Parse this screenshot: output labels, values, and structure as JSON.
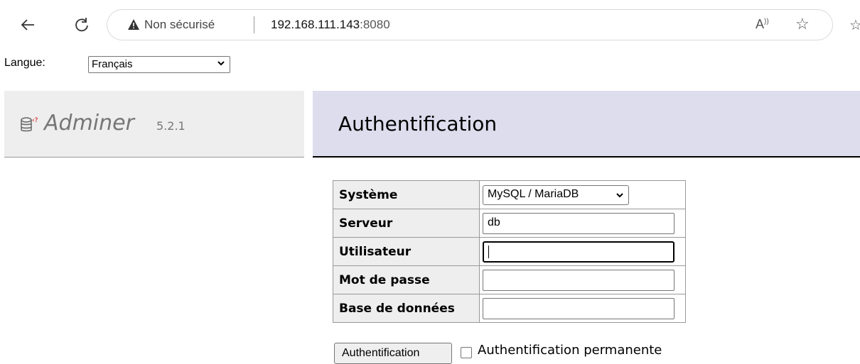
{
  "browser": {
    "security_text": "Non sécurisé",
    "url_host": "192.168.111.143",
    "url_port": ":8080",
    "read_aloud_icon": "Â",
    "icons": [
      "back-arrow-icon",
      "reload-icon",
      "warning-icon",
      "read-aloud-icon",
      "favorite-star-icon"
    ]
  },
  "language": {
    "label": "Langue:",
    "selected": "Français"
  },
  "logo": {
    "name": "Adminer",
    "version": "5.2.1"
  },
  "page": {
    "title": "Authentification"
  },
  "form": {
    "rows": [
      {
        "label": "Système",
        "value": "MySQL / MariaDB"
      },
      {
        "label": "Serveur",
        "value": "db"
      },
      {
        "label": "Utilisateur",
        "value": ""
      },
      {
        "label": "Mot de passe",
        "value": ""
      },
      {
        "label": "Base de données",
        "value": ""
      }
    ],
    "submit_label": "Authentification",
    "permanent_label": "Authentification permanente",
    "permanent_checked": false
  }
}
